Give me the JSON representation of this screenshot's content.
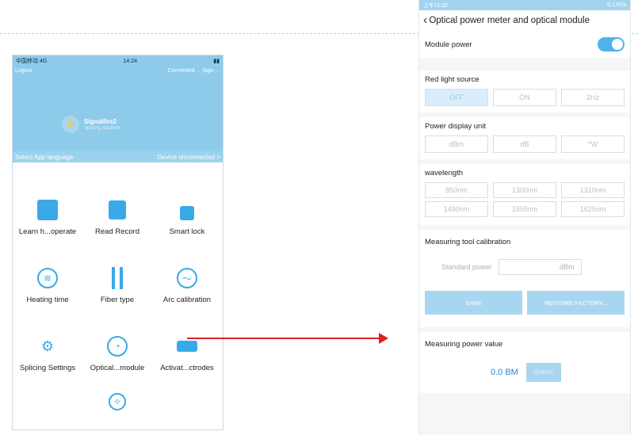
{
  "left_phone": {
    "status_bar": {
      "carrier": "中国移动 4G",
      "time": "14:24"
    },
    "logout_label": "Logout",
    "connection_label": "Connected ... Sign ...",
    "brand": {
      "name": "Signalfire2",
      "subtitle": "Splicing machine"
    },
    "language_label": "Select App language",
    "device_status": "Device unconnected >",
    "grid": [
      {
        "label": "Learn h...operate",
        "icon": "book-edit-icon"
      },
      {
        "label": "Read Record",
        "icon": "record-icon"
      },
      {
        "label": "Smart lock",
        "icon": "lock-icon"
      },
      {
        "label": "Heating time",
        "icon": "heating-icon"
      },
      {
        "label": "Fiber type",
        "icon": "fiber-type-icon"
      },
      {
        "label": "Arc calibration",
        "icon": "arc-calibration-icon"
      },
      {
        "label": "Splicing Settings",
        "icon": "splicing-settings-icon"
      },
      {
        "label": "Optical...module",
        "icon": "optical-module-icon"
      },
      {
        "label": "Activat...ctrodes",
        "icon": "electrode-icon"
      }
    ]
  },
  "right_phone": {
    "status_bar": {
      "time": "上午11:32",
      "network": "0.17K/s"
    },
    "title": "Optical power meter and optical module",
    "module_power_label": "Module power",
    "module_power_on": true,
    "red_light": {
      "label": "Red light source",
      "options": [
        "OFF",
        "ON",
        "2Hz"
      ],
      "selected": "OFF"
    },
    "power_unit": {
      "label": "Power display unit",
      "options": [
        "dBm",
        "dB",
        "*W"
      ]
    },
    "wavelength": {
      "label": "wavelength",
      "options": [
        "850nm",
        "1300nm",
        "1310nm",
        "1490nm",
        "1550nm",
        "1625nm"
      ]
    },
    "calibration": {
      "label": "Measuring tool calibration",
      "standard_power_label": "Standard power",
      "unit": "dBm",
      "save_label": "SAVE",
      "restore_label": "RESTORE FACTORY..."
    },
    "measuring": {
      "label": "Measuring power value",
      "value": "0.0 BM",
      "query_label": "QUERY"
    }
  },
  "colors": {
    "accent": "#4fb3ea",
    "header": "#8ecbeb",
    "arrow": "#e02020"
  }
}
